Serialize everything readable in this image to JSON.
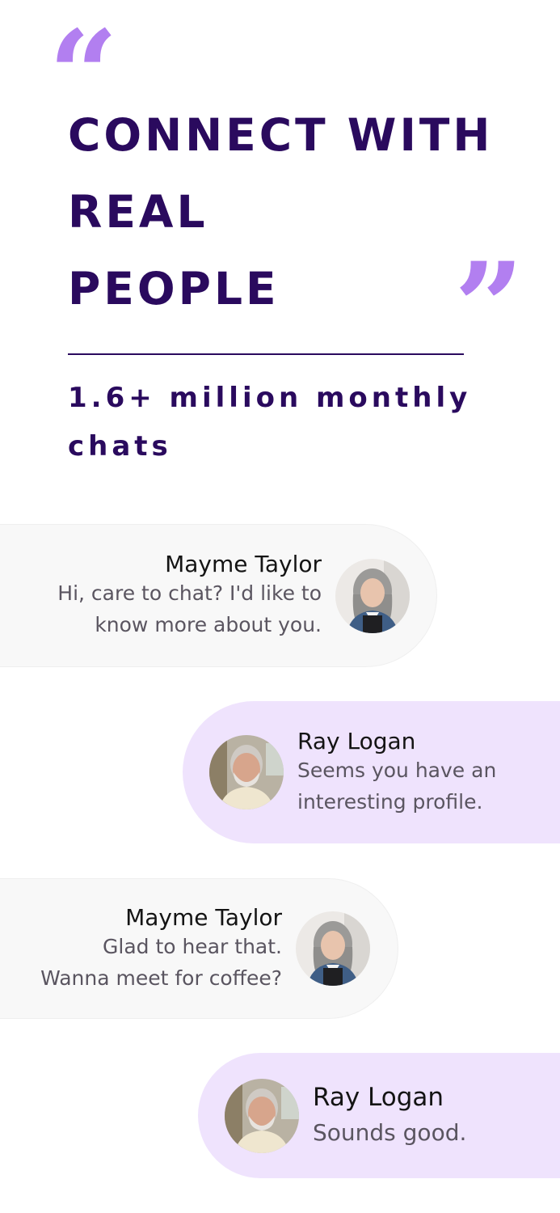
{
  "headline": {
    "line1": "CONNECT WITH",
    "line2": "REAL",
    "line3": "PEOPLE"
  },
  "quote_open": "“",
  "quote_close": "”",
  "subhead": "1.6+ million monthly chats",
  "chats": [
    {
      "name": "Mayme Taylor",
      "message": "Hi, care to chat? I'd like to\nknow more about you.",
      "avatar": "woman-gray-hair-avatar"
    },
    {
      "name": "Ray Logan",
      "message": "Seems you have an\ninteresting profile.",
      "avatar": "man-gray-beard-avatar"
    },
    {
      "name": "Mayme Taylor",
      "message": "Glad to hear that.\nWanna meet for coffee?",
      "avatar": "woman-gray-hair-avatar"
    },
    {
      "name": "Ray Logan",
      "message": "Sounds good.",
      "avatar": "man-gray-beard-avatar"
    }
  ],
  "colors": {
    "accent": "#b27ff0",
    "title": "#2a0a5e",
    "received_bubble": "#f8f8f8",
    "sent_bubble": "#efe3fd"
  }
}
